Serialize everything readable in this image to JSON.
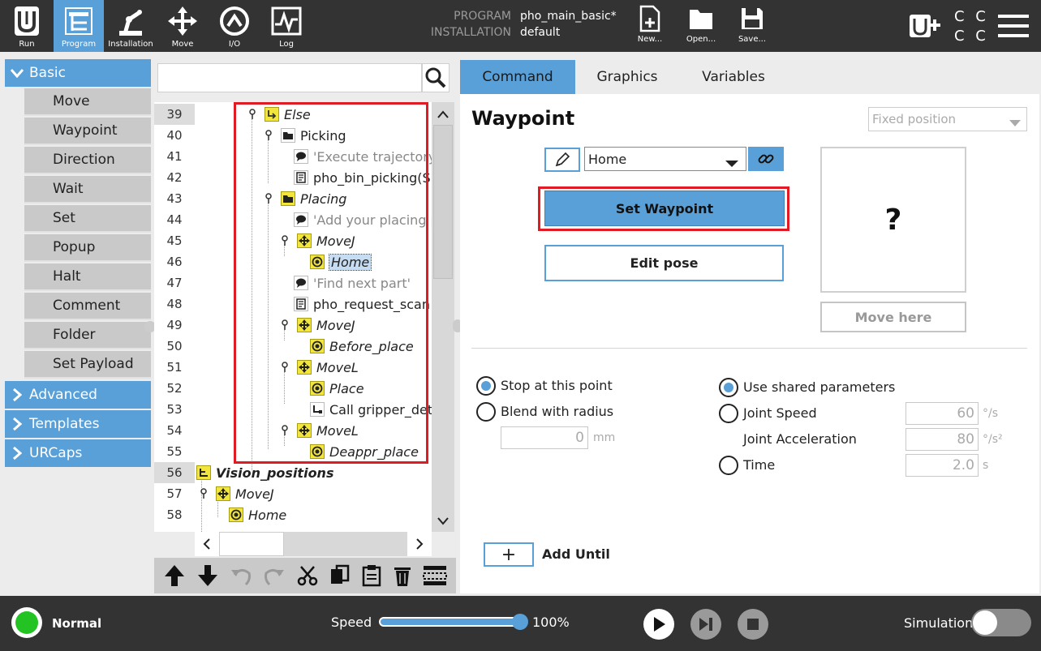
{
  "topbar": {
    "nav": [
      {
        "id": "run",
        "label": "Run"
      },
      {
        "id": "program",
        "label": "Program"
      },
      {
        "id": "installation",
        "label": "Installation"
      },
      {
        "id": "move",
        "label": "Move"
      },
      {
        "id": "io",
        "label": "I/O"
      },
      {
        "id": "log",
        "label": "Log"
      }
    ],
    "program_label": "PROGRAM",
    "program_value": "pho_main_basic*",
    "installation_label": "INSTALLATION",
    "installation_value": "default",
    "file_buttons": {
      "new": "New...",
      "open": "Open...",
      "save": "Save..."
    },
    "cc_text": "C C",
    "cc_text2": "C C"
  },
  "toolbox": {
    "basic": "Basic",
    "items": [
      "Move",
      "Waypoint",
      "Direction",
      "Wait",
      "Set",
      "Popup",
      "Halt",
      "Comment",
      "Folder",
      "Set Payload"
    ],
    "advanced": "Advanced",
    "templates": "Templates",
    "urcaps": "URCaps"
  },
  "tree": {
    "search_value": "",
    "lines": [
      "39",
      "40",
      "41",
      "42",
      "43",
      "44",
      "45",
      "46",
      "47",
      "48",
      "49",
      "50",
      "51",
      "52",
      "53",
      "54",
      "55",
      "56",
      "57",
      "58"
    ],
    "nodes": {
      "else": "Else",
      "picking": "Picking",
      "execute_comment": "'Execute trajectory",
      "bin_picking": "pho_bin_picking(S",
      "placing": "Placing",
      "add_placing": "'Add your placing p",
      "movej1": "MoveJ",
      "home1": "Home",
      "find_next": "'Find next part'",
      "request_scan": "pho_request_scan",
      "movej2": "MoveJ",
      "before_place": "Before_place",
      "movel1": "MoveL",
      "place": "Place",
      "call_gripper": "Call gripper_deta",
      "movel2": "MoveL",
      "deappr_place": "Deappr_place",
      "vision_positions": "Vision_positions",
      "movej3": "MoveJ",
      "home2": "Home"
    }
  },
  "tabs": {
    "command": "Command",
    "graphics": "Graphics",
    "variables": "Variables"
  },
  "waypoint": {
    "title": "Waypoint",
    "position_type": "Fixed position",
    "name": "Home",
    "set_waypoint": "Set Waypoint",
    "edit_pose": "Edit pose",
    "preview": "?",
    "move_here": "Move here",
    "stop_at_point": "Stop at this point",
    "blend_radius": "Blend with radius",
    "blend_value": "0",
    "blend_unit": "mm",
    "use_shared": "Use shared parameters",
    "joint_speed": "Joint Speed",
    "joint_speed_value": "60",
    "joint_speed_unit": "°/s",
    "joint_accel": "Joint Acceleration",
    "joint_accel_value": "80",
    "joint_accel_unit": "°/s²",
    "time": "Time",
    "time_value": "2.0",
    "time_unit": "s",
    "add_until_symbol": "+",
    "add_until": "Add Until"
  },
  "bottombar": {
    "status": "Normal",
    "speed_label": "Speed",
    "speed_value": "100%",
    "speed_fraction": 1.0,
    "simulation_label": "Simulation"
  },
  "colors": {
    "accent": "#5aa0d8",
    "highlight_red": "#e01b24",
    "topbar": "#333333",
    "status_green": "#22c322"
  }
}
